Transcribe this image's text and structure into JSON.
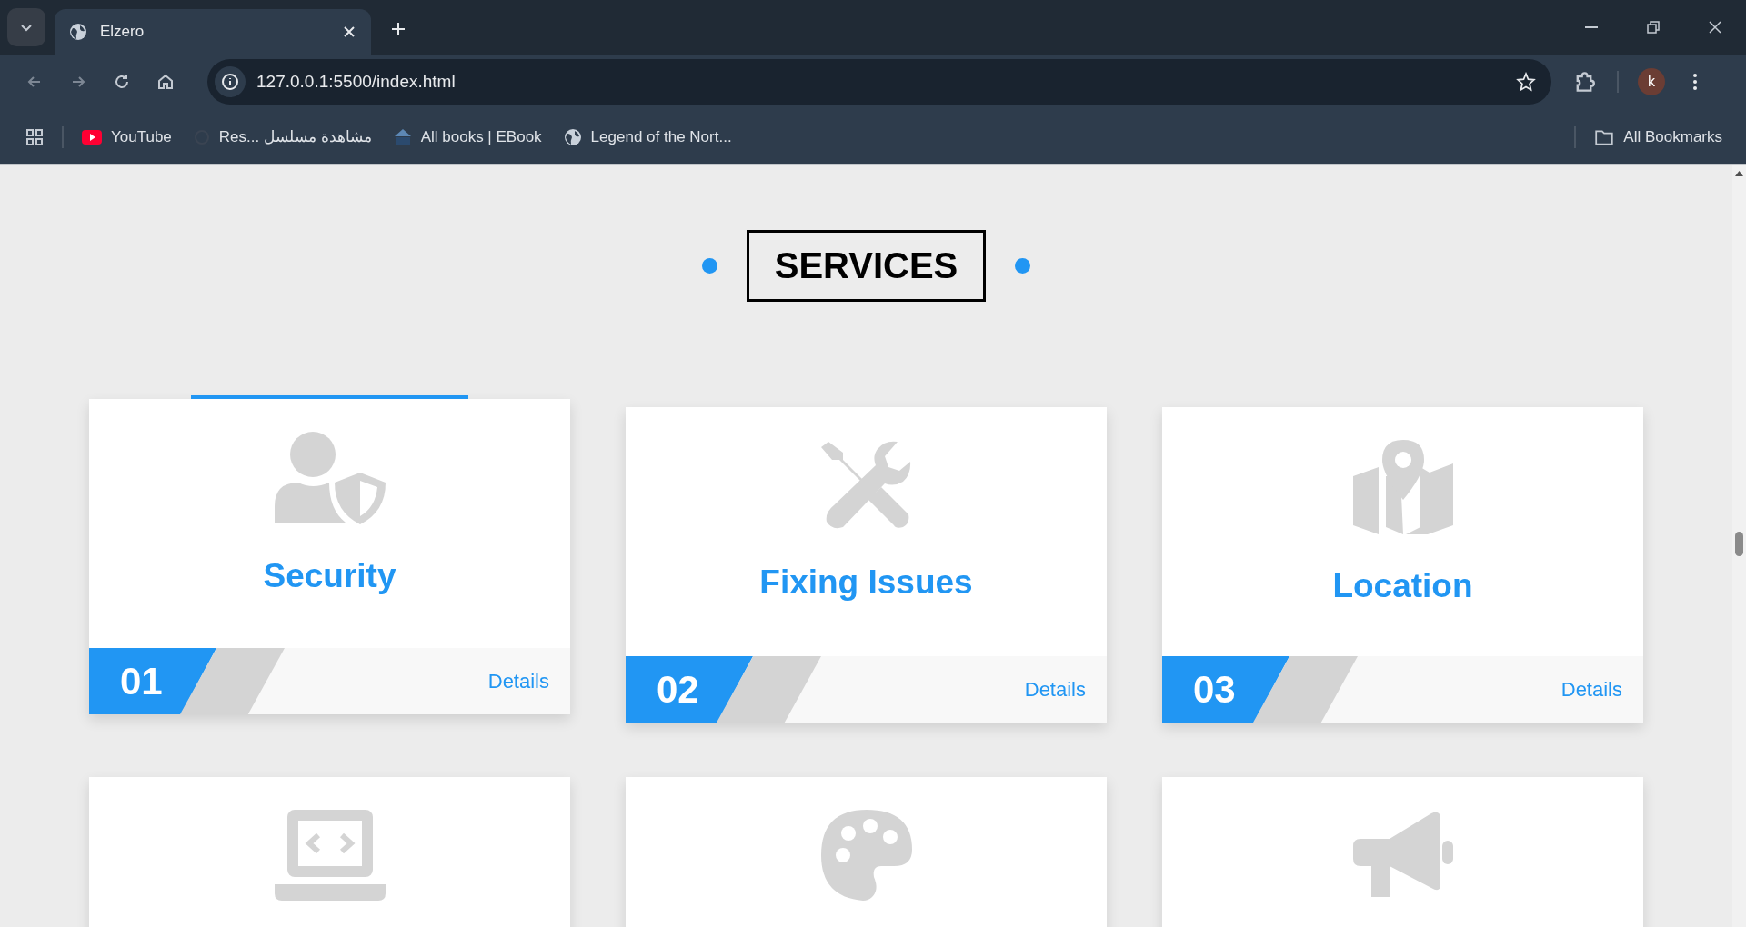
{
  "browser": {
    "tabs": [
      {
        "title": "Elzero",
        "selected": true
      }
    ],
    "address": "127.0.0.1:5500/index.html",
    "profile": "k",
    "bookmarks": [
      {
        "label": "YouTube",
        "kind": "youtube"
      },
      {
        "label": "Res... مشاهدة مسلسل",
        "kind": "spinner"
      },
      {
        "label": "All books | EBook",
        "kind": "library"
      },
      {
        "label": "Legend of the Nort...",
        "kind": "globe"
      }
    ],
    "all_bookmarks": "All Bookmarks"
  },
  "section_title": "SERVICES",
  "cards": [
    {
      "kind": "user-shield",
      "title": "Security",
      "number": "01",
      "details": "Details",
      "hovered": true
    },
    {
      "kind": "tools",
      "title": "Fixing Issues",
      "number": "02",
      "details": "Details",
      "hovered": false
    },
    {
      "kind": "map",
      "title": "Location",
      "number": "03",
      "details": "Details",
      "hovered": false
    },
    {
      "kind": "laptop-code",
      "hovered": false
    },
    {
      "kind": "palette",
      "hovered": false
    },
    {
      "kind": "megaphone",
      "hovered": false
    }
  ]
}
